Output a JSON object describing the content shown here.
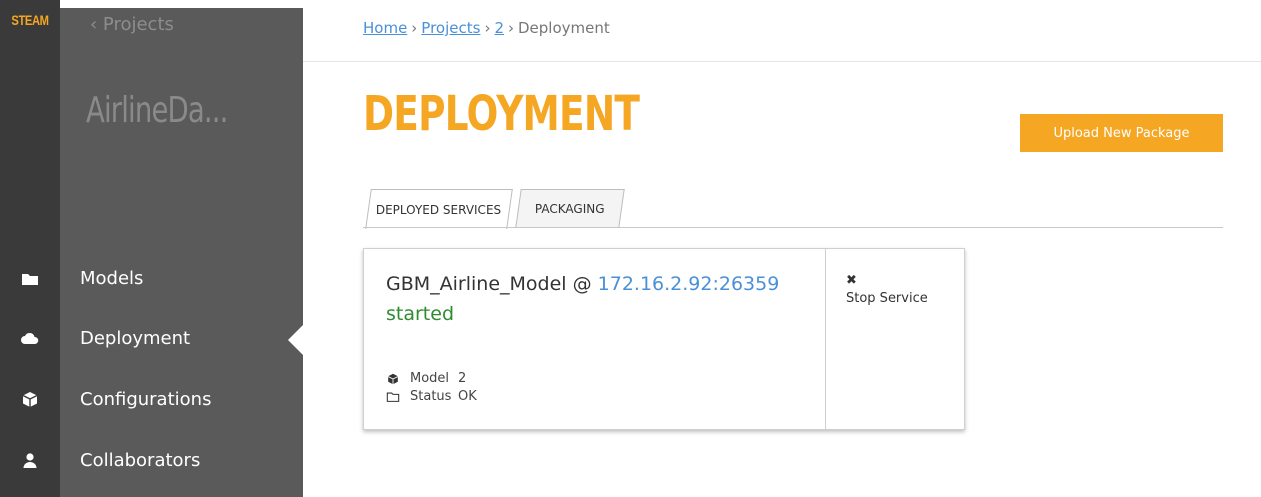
{
  "brand": "STEAM",
  "sidebar": {
    "back_label": "‹ Projects",
    "project_title": "AirlineDa...",
    "items": [
      {
        "label": "Models",
        "icon": "folder-icon"
      },
      {
        "label": "Deployment",
        "icon": "cloud-icon"
      },
      {
        "label": "Configurations",
        "icon": "cube-icon"
      },
      {
        "label": "Collaborators",
        "icon": "user-icon"
      }
    ]
  },
  "breadcrumb": {
    "home": "Home",
    "projects": "Projects",
    "project_id": "2",
    "current": "Deployment",
    "separator": "›"
  },
  "page": {
    "title": "DEPLOYMENT",
    "upload_button": "Upload New Package"
  },
  "tabs": [
    {
      "label": "DEPLOYED SERVICES",
      "active": true
    },
    {
      "label": "PACKAGING",
      "active": false
    }
  ],
  "service": {
    "name": "GBM_Airline_Model @ ",
    "address": "172.16.2.92:26359",
    "status": "started",
    "model_key": "Model",
    "model_value": "2",
    "status_key": "Status",
    "status_value": "OK",
    "stop_icon": "✖",
    "stop_label": "Stop Service"
  },
  "colors": {
    "accent": "#f5a623",
    "rail": "#3a3a3a",
    "sidebar": "#5a5a5a",
    "link": "#4a90d9",
    "status_ok": "#2e8b2e"
  }
}
